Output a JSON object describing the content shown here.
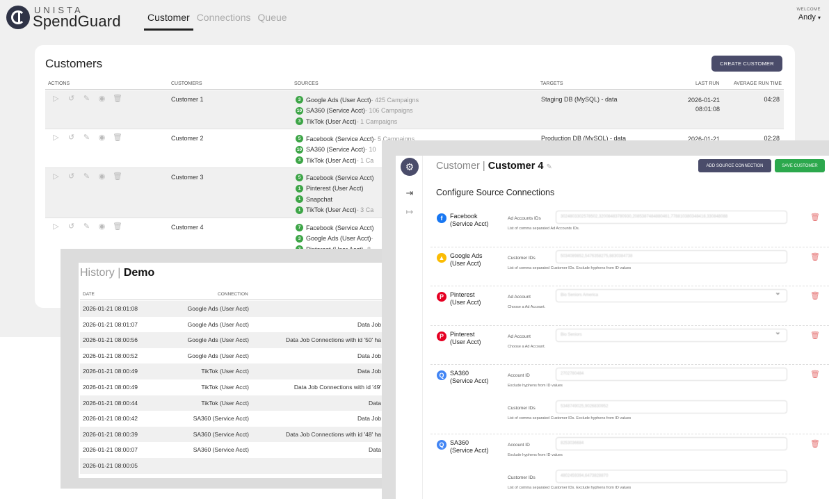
{
  "app": {
    "brand_top": "UNISTA",
    "brand_bottom": "SpendGuard",
    "nav": [
      {
        "label": "Customer",
        "active": true
      },
      {
        "label": "Connections",
        "active": false
      },
      {
        "label": "Queue",
        "active": false
      }
    ],
    "welcome": "WELCOME",
    "user": "Andy"
  },
  "customers": {
    "title": "Customers",
    "create_button": "CREATE CUSTOMER",
    "columns": {
      "actions": "ACTIONS",
      "customers": "CUSTOMERS",
      "sources": "SOURCES",
      "targets": "TARGETS",
      "last_run": "LAST RUN",
      "avg_run_time": "AVERAGE RUN TIME"
    },
    "rows": [
      {
        "name": "Customer 1",
        "sources": [
          {
            "count": "3",
            "name": "Google Ads (User Acct)",
            "detail": " - 425 Campaigns"
          },
          {
            "count": "10",
            "name": "SA360 (Service Acct)",
            "detail": " - 106 Campaigns"
          },
          {
            "count": "3",
            "name": "TikTok (User Acct)",
            "detail": " - 1 Campaigns"
          }
        ],
        "target": "Staging DB (MySQL) - data",
        "last_run_date": "2026-01-21",
        "last_run_time": "08:01:08",
        "avg": "04:28"
      },
      {
        "name": "Customer 2",
        "sources": [
          {
            "count": "5",
            "name": "Facebook (Service Acct)",
            "detail": " - 5 Campaigns"
          },
          {
            "count": "10",
            "name": "SA360 (Service Acct)",
            "detail": " - 10"
          },
          {
            "count": "3",
            "name": "TikTok (User Acct)",
            "detail": " - 1 Ca"
          }
        ],
        "target": "Production DB (MySQL) - data",
        "last_run_date": "2026-01-21",
        "last_run_time": "",
        "avg": "02:28"
      },
      {
        "name": "Customer 3",
        "sources": [
          {
            "count": "5",
            "name": "Facebook (Service Acct)",
            "detail": ""
          },
          {
            "count": "1",
            "name": "Pinterest (User Acct)",
            "detail": ""
          },
          {
            "count": "1",
            "name": "Snapchat",
            "detail": ""
          },
          {
            "count": "1",
            "name": "TikTok (User Acct)",
            "detail": " - 3 Ca"
          }
        ],
        "target": "",
        "last_run_date": "",
        "last_run_time": "",
        "avg": ""
      },
      {
        "name": "Customer 4",
        "sources": [
          {
            "count": "7",
            "name": "Facebook (Service Acct)",
            "detail": ""
          },
          {
            "count": "3",
            "name": "Google Ads (User Acct)",
            "detail": " -"
          },
          {
            "count": "3",
            "name": "Pinterest (User Acct)",
            "detail": " - 8"
          }
        ],
        "target": "",
        "last_run_date": "",
        "last_run_time": "",
        "avg": ""
      }
    ]
  },
  "history": {
    "title_prefix": "History | ",
    "title_name": "Demo",
    "columns": {
      "date": "DATE",
      "connection": "CONNECTION"
    },
    "rows": [
      {
        "date": "2026-01-21 08:01:08",
        "connection": "Google Ads (User Acct)",
        "message": ""
      },
      {
        "date": "2026-01-21 08:01:07",
        "connection": "Google Ads (User Acct)",
        "message": "Data Job"
      },
      {
        "date": "2026-01-21 08:00:56",
        "connection": "Google Ads (User Acct)",
        "message": "Data Job Connections with id '50' ha"
      },
      {
        "date": "2026-01-21 08:00:52",
        "connection": "Google Ads (User Acct)",
        "message": "Data Job"
      },
      {
        "date": "2026-01-21 08:00:49",
        "connection": "TikTok (User Acct)",
        "message": "Data Job"
      },
      {
        "date": "2026-01-21 08:00:49",
        "connection": "TikTok (User Acct)",
        "message": "Data Job Connections with id '49'"
      },
      {
        "date": "2026-01-21 08:00:44",
        "connection": "TikTok (User Acct)",
        "message": "Data"
      },
      {
        "date": "2026-01-21 08:00:42",
        "connection": "SA360 (Service Acct)",
        "message": "Data Job"
      },
      {
        "date": "2026-01-21 08:00:39",
        "connection": "SA360 (Service Acct)",
        "message": "Data Job Connections with id '48' ha"
      },
      {
        "date": "2026-01-21 08:00:07",
        "connection": "SA360 (Service Acct)",
        "message": "Data"
      },
      {
        "date": "2026-01-21 08:00:05",
        "connection": "",
        "message": ""
      }
    ]
  },
  "customer4": {
    "title_prefix": "Customer | ",
    "title_name": "Customer 4",
    "add_button": "ADD SOURCE CONNECTION",
    "save_button": "SAVE CUSTOMER",
    "section_title": "Configure Source Connections",
    "sources": [
      {
        "name1": "Facebook",
        "name2": "(Service Acct)",
        "icon": "facebook-icon",
        "color": "#1877f2",
        "fields": [
          {
            "label": "Ad Accounts IDs",
            "value": "3024803302578502,32008483780930,2085387484880461,778810380348418,330848088",
            "help": "List of comma separated Ad Accounts IDs.",
            "select": false
          }
        ]
      },
      {
        "name1": "Google Ads",
        "name2": "(User Acct)",
        "icon": "google-ads-icon",
        "color": "#fbbc04",
        "fields": [
          {
            "label": "Customer IDs",
            "value": "5034089852,5476358275,8830384738",
            "help": "List of comma separated Customer IDs. Exclude hyphens from ID values",
            "select": false
          }
        ]
      },
      {
        "name1": "Pinterest",
        "name2": "(User Acct)",
        "icon": "pinterest-icon",
        "color": "#e60023",
        "fields": [
          {
            "label": "Ad Account",
            "value": "Bio Seniors America",
            "help": "Choose a Ad Account.",
            "select": true
          }
        ]
      },
      {
        "name1": "Pinterest",
        "name2": "(User Acct)",
        "icon": "pinterest-icon",
        "color": "#e60023",
        "fields": [
          {
            "label": "Ad Account",
            "value": "Bio Seniors",
            "help": "Choose a Ad Account.",
            "select": true
          }
        ]
      },
      {
        "name1": "SA360",
        "name2": "(Service Acct)",
        "icon": "sa360-icon",
        "color": "#4285f4",
        "fields": [
          {
            "label": "Account ID",
            "value": "2702780484",
            "help": "Exclude hyphens from ID values",
            "select": false
          },
          {
            "label": "Customer IDs",
            "value": "5348749025,9026830952",
            "help": "List of comma separated Customer IDs. Exclude hyphens from ID values",
            "select": false
          }
        ]
      },
      {
        "name1": "SA360",
        "name2": "(Service Acct)",
        "icon": "sa360-icon",
        "color": "#4285f4",
        "fields": [
          {
            "label": "Account ID",
            "value": "8253036684",
            "help": "Exclude hyphens from ID values",
            "select": false
          },
          {
            "label": "Customer IDs",
            "value": "4802459394,6473828870",
            "help": "List of comma separated Customer IDs. Exclude hyphens from ID values",
            "select": false
          }
        ]
      }
    ]
  }
}
